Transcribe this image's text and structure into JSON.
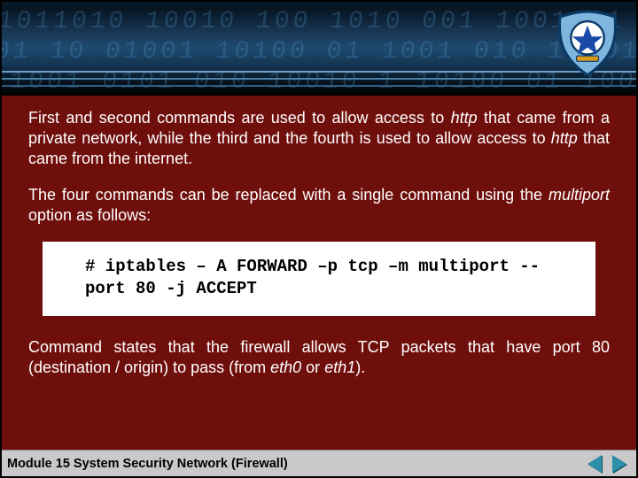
{
  "header": {
    "logo_name": "tut-wuri-handayani-logo"
  },
  "body": {
    "para1_a": "First and second commands are used to allow access to ",
    "para1_http1": "http",
    "para1_b": " that came from a private network, while the third and the fourth is used to allow access to ",
    "para1_http2": "http",
    "para1_c": " that came from the internet.",
    "para2_a": "The four commands can be replaced with a single command using the ",
    "para2_mp": "multiport",
    "para2_b": " option as follows:",
    "code": "# iptables – A FORWARD –p tcp –m multiport --port 80 -j ACCEPT",
    "para3_a": "Command states that the firewall allows TCP packets that have port 80 (destination / origin) to pass (from ",
    "para3_eth0": "eth0",
    "para3_or": " or ",
    "para3_eth1": "eth1",
    "para3_end": ")."
  },
  "footer": {
    "title": "Module 15 System Security Network (Firewall)",
    "prev_label": "previous-slide",
    "next_label": "next-slide"
  }
}
